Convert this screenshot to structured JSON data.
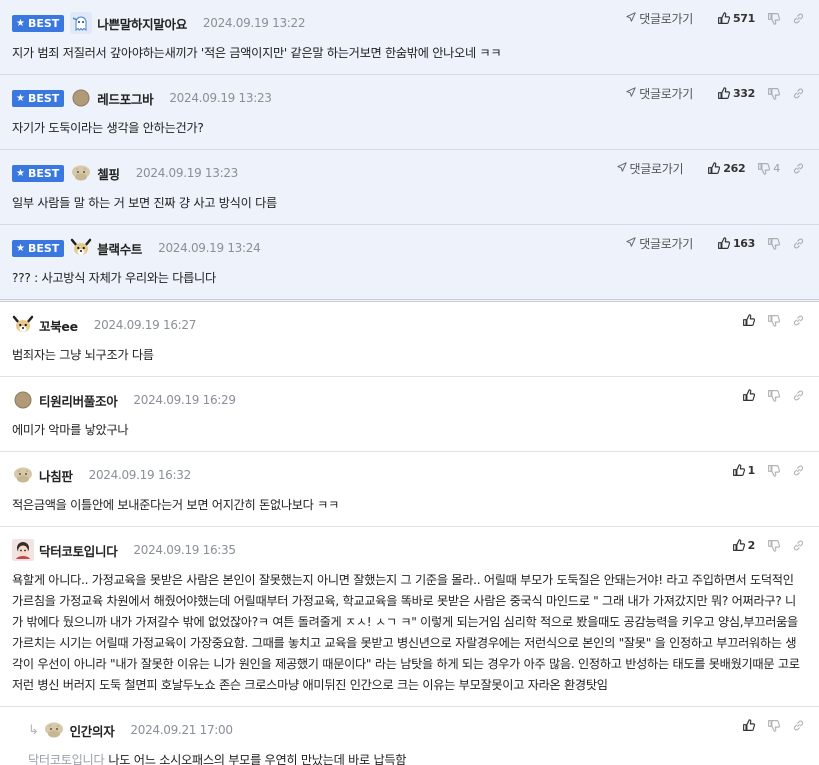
{
  "reply_label": "댓글로가기",
  "best_label": "BEST",
  "best_comments": [
    {
      "nick": "나쁜말하지말아요",
      "date": "2024.09.19 13:22",
      "avatar": "blue-ghost-avatar",
      "likes": "571",
      "dislikes": "",
      "text": "지가 범죄 저질러서 갚아야하는새끼가 '적은 금액이지만' 같은말 하는거보면 한숨밖에 안나오네 ㅋㅋ"
    },
    {
      "nick": "레드포그바",
      "date": "2024.09.19 13:23",
      "avatar": "round-avatar",
      "likes": "332",
      "dislikes": "",
      "text": "자기가 도둑이라는 생각을 안하는건가?"
    },
    {
      "nick": "첼핑",
      "date": "2024.09.19 13:23",
      "avatar": "mushroom-avatar",
      "likes": "262",
      "dislikes": "4",
      "text": "일부 사람들 말 하는 거 보면 진짜 걍 사고 방식이 다름"
    },
    {
      "nick": "블랙수트",
      "date": "2024.09.19 13:24",
      "avatar": "dog-avatar",
      "likes": "163",
      "dislikes": "",
      "text": "??? : 사고방식 자체가 우리와는 다릅니다"
    }
  ],
  "comments": [
    {
      "nick": "꼬북ee",
      "date": "2024.09.19 16:27",
      "avatar": "dog-avatar",
      "likes": "",
      "dislikes": "",
      "text": "범죄자는 그냥 뇌구조가 다름"
    },
    {
      "nick": "티원리버풀조아",
      "date": "2024.09.19 16:29",
      "avatar": "round-avatar",
      "likes": "",
      "dislikes": "",
      "text": "에미가 악마를 낳았구나"
    },
    {
      "nick": "나침판",
      "date": "2024.09.19 16:32",
      "avatar": "mushroom-avatar",
      "likes": "1",
      "dislikes": "",
      "text": "적은금액을 이틀안에 보내준다는거 보면 어지간히 돈없나보다 ㅋㅋ"
    },
    {
      "nick": "닥터코토입니다",
      "date": "2024.09.19 16:35",
      "avatar": "character-avatar",
      "likes": "2",
      "dislikes": "",
      "text": "욕할게 아니다.. 가정교육을 못받은 사람은 본인이 잘못했는지 아니면 잘했는지 그 기준을 몰라.. 어릴때 부모가 도둑질은 안돼는거야! 라고 주입하면서 도덕적인 가르침을 가정교육 차원에서 해줬어야했는데 어릴때부터 가정교육, 학교교육을 똑바로 못받은 사람은 중국식 마인드로 \" 그래 내가 가져갔지만 뭐? 어쩌라구? 니가 밖에다 뒀으니까 내가 가져갈수 밖에 없었잖아?ㅋ 여튼 돌려줄게 ㅈㅅ! ㅅㄱ ㅋ\" 이렇게 되는거임 심리학 적으로 봤을때도 공감능력을 키우고 양심,부끄러움을 가르치는 시기는 어릴때 가정교육이 가장중요함. 그때를 놓치고 교육을 못받고 병신년으로 자랄경우에는 저런식으로 본인의 \"잘못\" 을 인정하고 부끄러워하는 생각이 우선이 아니라 \"내가 잘못한 이유는 니가 원인을 제공했기 때문이다\" 라는 남탓을 하게 되는 경우가 아주 많음. 인정하고 반성하는 태도를 못배웠기때문 고로 저런 병신 버러지 도둑 철면피 호날두노쇼 존슨 크로스마냥 애미뒤진 인간으로 크는 이유는 부모잘못이고 자라온 환경탓임"
    }
  ],
  "reply": {
    "nick": "인간의자",
    "date": "2024.09.21 17:00",
    "avatar": "mushroom-avatar",
    "mention": "닥터코토입니다",
    "text": "나도 어느 소시오패스의 부모를 우연히 만났는데 바로 납득함",
    "likes": "",
    "dislikes": ""
  }
}
